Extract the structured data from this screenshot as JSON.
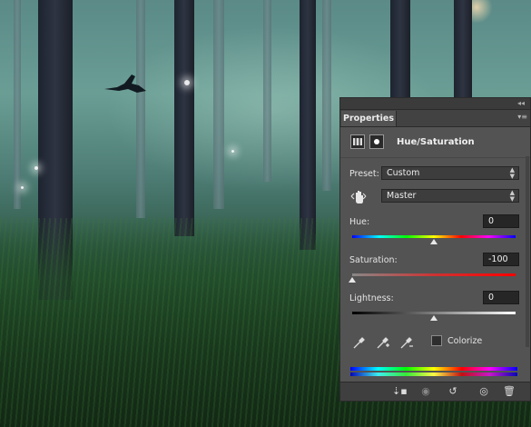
{
  "panel": {
    "tab_label": "Properties",
    "title": "Hue/Saturation",
    "preset": {
      "label": "Preset:",
      "value": "Custom"
    },
    "channel": {
      "value": "Master"
    },
    "hue": {
      "label": "Hue:",
      "value": "0",
      "position_fraction": 0.5
    },
    "saturation": {
      "label": "Saturation:",
      "value": "-100",
      "position_fraction": 0.0
    },
    "lightness": {
      "label": "Lightness:",
      "value": "0",
      "position_fraction": 0.5
    },
    "colorize": {
      "label": "Colorize",
      "checked": false
    }
  },
  "icons": {
    "collapse": "double-chevron-icon",
    "panel_menu": "panel-menu-icon",
    "adjustment": "hue-saturation-adjustment-icon",
    "mask": "layer-mask-icon",
    "targeted_adjustment": "hand-adjust-icon",
    "eyedroppers": [
      "eyedropper-icon",
      "eyedropper-plus-icon",
      "eyedropper-minus-icon"
    ],
    "footer": [
      "clip-to-layer-icon",
      "view-previous-state-icon",
      "reset-icon",
      "visibility-eye-icon",
      "trash-icon"
    ]
  },
  "colors": {
    "panel_bg": "#535353",
    "field_bg": "#262626"
  }
}
